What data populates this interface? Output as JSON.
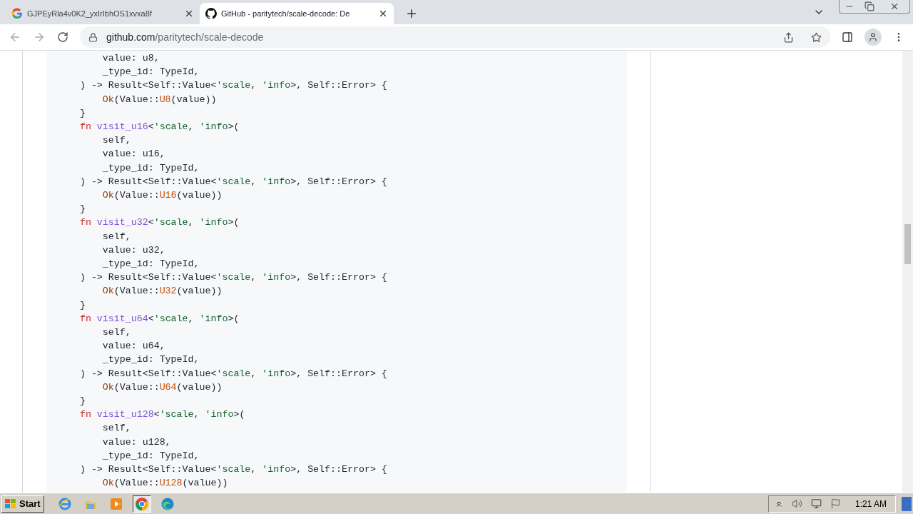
{
  "tabs": [
    {
      "title": "GJPEyRla4v0K2_yxIrIbhOS1xvxa8f",
      "selected": false,
      "kind": "google"
    },
    {
      "title": "GitHub - paritytech/scale-decode: De",
      "selected": true,
      "kind": "github"
    }
  ],
  "address": {
    "host": "github.com",
    "path": "/paritytech/scale-decode"
  },
  "code": [
    [
      {
        "kind": "plain",
        "text": "        value: u8,"
      }
    ],
    [
      {
        "kind": "plain",
        "text": "        _type_id: TypeId,"
      }
    ],
    [
      {
        "kind": "plain",
        "text": "    ) -> Result<Self::Value<"
      },
      {
        "kind": "lifetime",
        "text": "'scale"
      },
      {
        "kind": "plain",
        "text": ", "
      },
      {
        "kind": "lifetime",
        "text": "'info"
      },
      {
        "kind": "plain",
        "text": ">, Self::Error> {"
      }
    ],
    [
      {
        "kind": "call",
        "text": "        Ok"
      },
      {
        "kind": "plain",
        "text": "(Value::"
      },
      {
        "kind": "variant",
        "text": "U8"
      },
      {
        "kind": "plain",
        "text": "(value))"
      }
    ],
    [
      {
        "kind": "plain",
        "text": "    }"
      }
    ],
    [
      {
        "kind": "keyword",
        "text": "    fn "
      },
      {
        "kind": "function",
        "text": "visit_u16"
      },
      {
        "kind": "plain",
        "text": "<"
      },
      {
        "kind": "lifetime",
        "text": "'scale"
      },
      {
        "kind": "plain",
        "text": ", "
      },
      {
        "kind": "lifetime",
        "text": "'info"
      },
      {
        "kind": "plain",
        "text": ">("
      }
    ],
    [
      {
        "kind": "plain",
        "text": "        self,"
      }
    ],
    [
      {
        "kind": "plain",
        "text": "        value: u16,"
      }
    ],
    [
      {
        "kind": "plain",
        "text": "        _type_id: TypeId,"
      }
    ],
    [
      {
        "kind": "plain",
        "text": "    ) -> Result<Self::Value<"
      },
      {
        "kind": "lifetime",
        "text": "'scale"
      },
      {
        "kind": "plain",
        "text": ", "
      },
      {
        "kind": "lifetime",
        "text": "'info"
      },
      {
        "kind": "plain",
        "text": ">, Self::Error> {"
      }
    ],
    [
      {
        "kind": "call",
        "text": "        Ok"
      },
      {
        "kind": "plain",
        "text": "(Value::"
      },
      {
        "kind": "variant",
        "text": "U16"
      },
      {
        "kind": "plain",
        "text": "(value))"
      }
    ],
    [
      {
        "kind": "plain",
        "text": "    }"
      }
    ],
    [
      {
        "kind": "keyword",
        "text": "    fn "
      },
      {
        "kind": "function",
        "text": "visit_u32"
      },
      {
        "kind": "plain",
        "text": "<"
      },
      {
        "kind": "lifetime",
        "text": "'scale"
      },
      {
        "kind": "plain",
        "text": ", "
      },
      {
        "kind": "lifetime",
        "text": "'info"
      },
      {
        "kind": "plain",
        "text": ">("
      }
    ],
    [
      {
        "kind": "plain",
        "text": "        self,"
      }
    ],
    [
      {
        "kind": "plain",
        "text": "        value: u32,"
      }
    ],
    [
      {
        "kind": "plain",
        "text": "        _type_id: TypeId,"
      }
    ],
    [
      {
        "kind": "plain",
        "text": "    ) -> Result<Self::Value<"
      },
      {
        "kind": "lifetime",
        "text": "'scale"
      },
      {
        "kind": "plain",
        "text": ", "
      },
      {
        "kind": "lifetime",
        "text": "'info"
      },
      {
        "kind": "plain",
        "text": ">, Self::Error> {"
      }
    ],
    [
      {
        "kind": "call",
        "text": "        Ok"
      },
      {
        "kind": "plain",
        "text": "(Value::"
      },
      {
        "kind": "variant",
        "text": "U32"
      },
      {
        "kind": "plain",
        "text": "(value))"
      }
    ],
    [
      {
        "kind": "plain",
        "text": "    }"
      }
    ],
    [
      {
        "kind": "keyword",
        "text": "    fn "
      },
      {
        "kind": "function",
        "text": "visit_u64"
      },
      {
        "kind": "plain",
        "text": "<"
      },
      {
        "kind": "lifetime",
        "text": "'scale"
      },
      {
        "kind": "plain",
        "text": ", "
      },
      {
        "kind": "lifetime",
        "text": "'info"
      },
      {
        "kind": "plain",
        "text": ">("
      }
    ],
    [
      {
        "kind": "plain",
        "text": "        self,"
      }
    ],
    [
      {
        "kind": "plain",
        "text": "        value: u64,"
      }
    ],
    [
      {
        "kind": "plain",
        "text": "        _type_id: TypeId,"
      }
    ],
    [
      {
        "kind": "plain",
        "text": "    ) -> Result<Self::Value<"
      },
      {
        "kind": "lifetime",
        "text": "'scale"
      },
      {
        "kind": "plain",
        "text": ", "
      },
      {
        "kind": "lifetime",
        "text": "'info"
      },
      {
        "kind": "plain",
        "text": ">, Self::Error> {"
      }
    ],
    [
      {
        "kind": "call",
        "text": "        Ok"
      },
      {
        "kind": "plain",
        "text": "(Value::"
      },
      {
        "kind": "variant",
        "text": "U64"
      },
      {
        "kind": "plain",
        "text": "(value))"
      }
    ],
    [
      {
        "kind": "plain",
        "text": "    }"
      }
    ],
    [
      {
        "kind": "keyword",
        "text": "    fn "
      },
      {
        "kind": "function",
        "text": "visit_u128"
      },
      {
        "kind": "plain",
        "text": "<"
      },
      {
        "kind": "lifetime",
        "text": "'scale"
      },
      {
        "kind": "plain",
        "text": ", "
      },
      {
        "kind": "lifetime",
        "text": "'info"
      },
      {
        "kind": "plain",
        "text": ">("
      }
    ],
    [
      {
        "kind": "plain",
        "text": "        self,"
      }
    ],
    [
      {
        "kind": "plain",
        "text": "        value: u128,"
      }
    ],
    [
      {
        "kind": "plain",
        "text": "        _type_id: TypeId,"
      }
    ],
    [
      {
        "kind": "plain",
        "text": "    ) -> Result<Self::Value<"
      },
      {
        "kind": "lifetime",
        "text": "'scale"
      },
      {
        "kind": "plain",
        "text": ", "
      },
      {
        "kind": "lifetime",
        "text": "'info"
      },
      {
        "kind": "plain",
        "text": ">, Self::Error> {"
      }
    ],
    [
      {
        "kind": "call",
        "text": "        Ok"
      },
      {
        "kind": "plain",
        "text": "(Value::"
      },
      {
        "kind": "variant",
        "text": "U128"
      },
      {
        "kind": "plain",
        "text": "(value))"
      }
    ]
  ],
  "taskbar": {
    "start": "Start",
    "apps": [
      {
        "kind": "ie",
        "selected": false
      },
      {
        "kind": "folder",
        "selected": false
      },
      {
        "kind": "media",
        "selected": false
      },
      {
        "kind": "chrome",
        "selected": true
      },
      {
        "kind": "edge",
        "selected": false
      }
    ],
    "time": "1:21 AM"
  }
}
